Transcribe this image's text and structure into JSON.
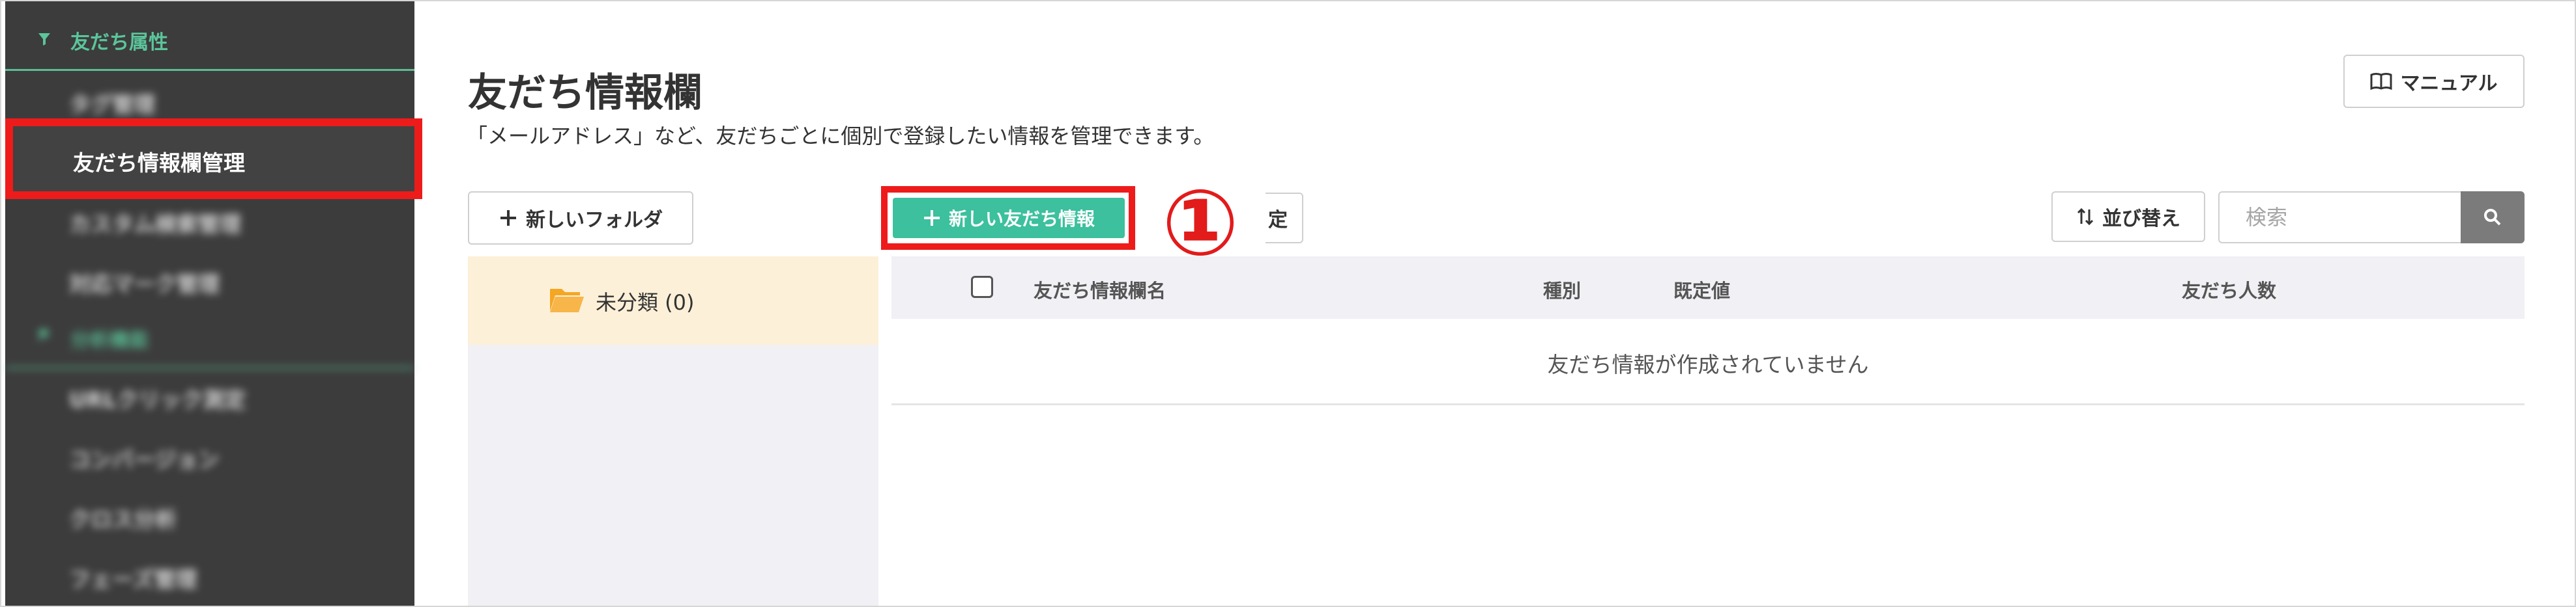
{
  "sidebar": {
    "section_friend_attr": "友だち属性",
    "items": [
      {
        "label": "タグ管理"
      },
      {
        "label": "友だち情報欄管理"
      },
      {
        "label": "カスタム検索管理"
      },
      {
        "label": "対応マーク管理"
      }
    ],
    "section_analysis": "分析機能",
    "analysis_items": [
      {
        "label": "URLクリック測定"
      },
      {
        "label": "コンバージョン"
      },
      {
        "label": "クロス分析"
      },
      {
        "label": "フェーズ管理"
      }
    ]
  },
  "header": {
    "title": "友だち情報欄",
    "description": "「メールアドレス」など、友だちごとに個別で登録したい情報を管理できます。",
    "manual_label": "マニュアル"
  },
  "toolbar": {
    "new_folder_label": "新しいフォルダ",
    "new_friend_info_label": "新しい友だち情報",
    "partial_label": "定",
    "sort_label": "並び替え",
    "search_placeholder": "検索"
  },
  "callout": "①",
  "folders": [
    {
      "label": "未分類 (0)"
    }
  ],
  "table": {
    "columns": [
      "友だち情報欄名",
      "種別",
      "既定値",
      "友だち人数"
    ],
    "empty_message": "友だち情報が作成されていません"
  },
  "colors": {
    "accent_green": "#3cc09d",
    "highlight_red": "#ee1b1b",
    "sidebar_bg": "#3c3c3c",
    "folder_orange": "#f5a623"
  }
}
